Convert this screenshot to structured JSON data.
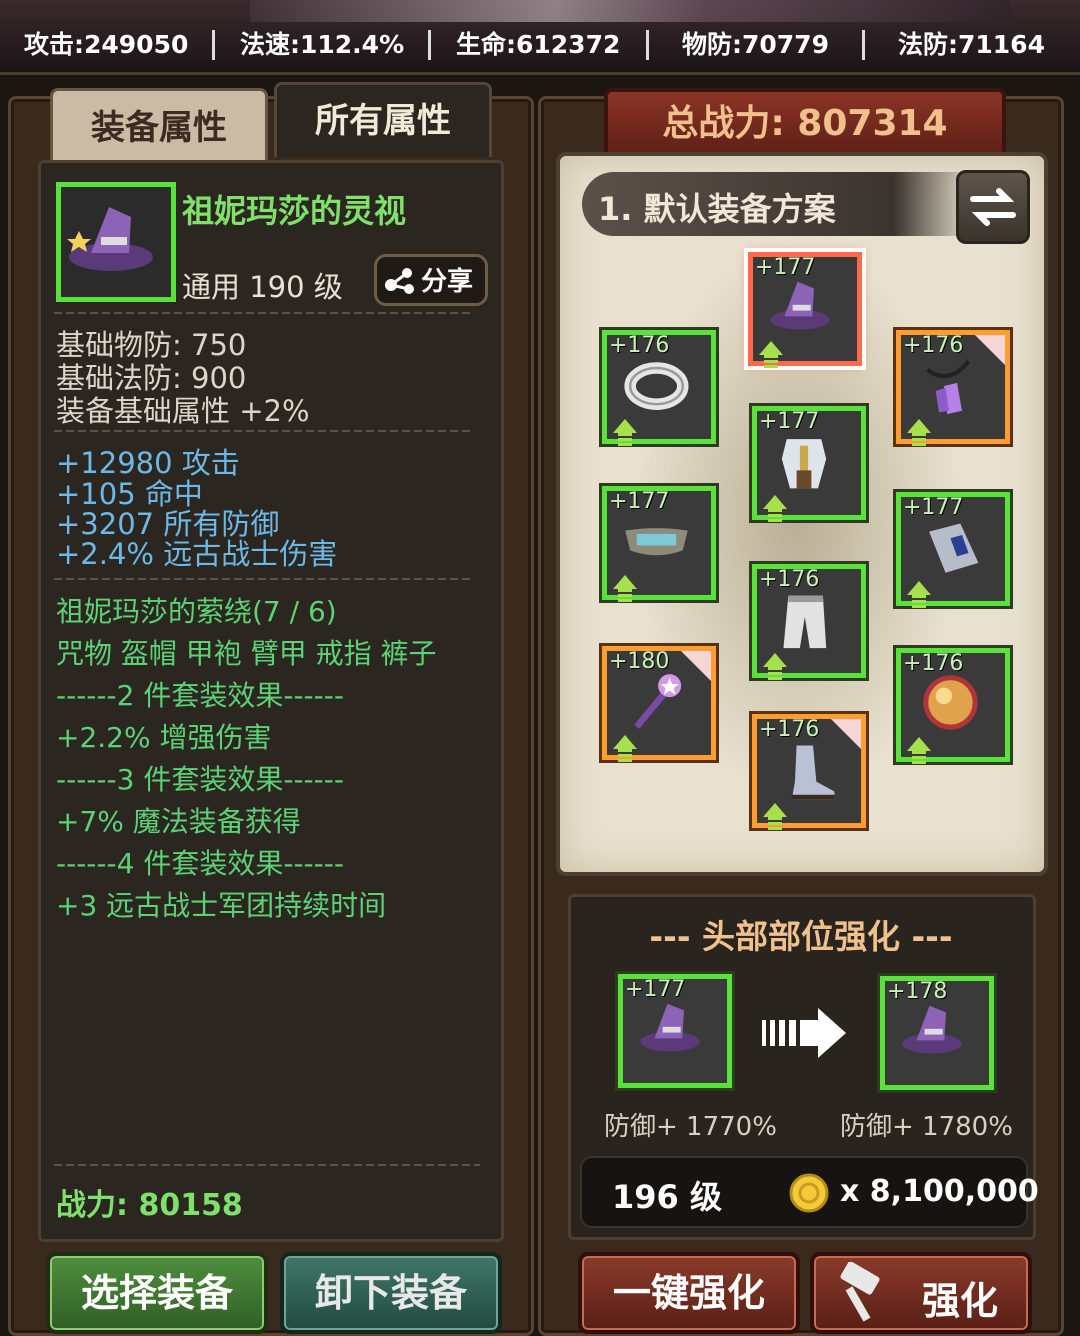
{
  "stats": {
    "attack": "攻击:249050",
    "cast_speed": "法速:112.4%",
    "hp": "生命:612372",
    "phys_def": "物防:70779",
    "magic_def": "法防:71164"
  },
  "tabs": {
    "equip_attr": "装备属性",
    "all_attr": "所有属性"
  },
  "item": {
    "name": "祖妮玛莎的灵视",
    "type_level": "通用 190 级",
    "share_label": "分享",
    "base_stats": [
      "基础物防:  750",
      "基础法防:  900",
      "装备基础属性 +2%"
    ],
    "bonus_stats": [
      "+12980 攻击",
      "+105 命中",
      "+3207 所有防御",
      "+2.4% 远古战士伤害"
    ],
    "set_name": "祖妮玛莎的萦绕(7 / 6)",
    "set_parts": "咒物 盔帽 甲袍 臂甲 戒指 裤子",
    "set_effects": [
      "------2 件套装效果------",
      "+2.2% 增强伤害",
      "------3 件套装效果------",
      "+7% 魔法装备获得",
      "------4 件套装效果------",
      "+3 远古战士军团持续时间"
    ],
    "power": "战力: 80158"
  },
  "buttons": {
    "select": "选择装备",
    "unequip": "卸下装备",
    "one_click": "一键强化",
    "enhance": "强化"
  },
  "total_power": "总战力: 807314",
  "loadout": {
    "name": "1. 默认装备方案",
    "slots": [
      {
        "id": "hat",
        "level": "+177",
        "rarity": "green",
        "icon": "wizard-hat-icon",
        "selected": true
      },
      {
        "id": "ring",
        "level": "+176",
        "rarity": "green",
        "icon": "ring-icon"
      },
      {
        "id": "amulet",
        "level": "+176",
        "rarity": "orange",
        "icon": "crystal-necklace-icon"
      },
      {
        "id": "armor",
        "level": "+177",
        "rarity": "green",
        "icon": "armor-icon"
      },
      {
        "id": "belt",
        "level": "+177",
        "rarity": "green",
        "icon": "belt-icon"
      },
      {
        "id": "bracer",
        "level": "+177",
        "rarity": "green",
        "icon": "bracer-icon"
      },
      {
        "id": "pants",
        "level": "+176",
        "rarity": "green",
        "icon": "pants-icon"
      },
      {
        "id": "wand",
        "level": "+180",
        "rarity": "orange",
        "icon": "wand-icon"
      },
      {
        "id": "orb",
        "level": "+176",
        "rarity": "green",
        "icon": "orb-icon"
      },
      {
        "id": "boots",
        "level": "+176",
        "rarity": "orange",
        "icon": "boots-icon"
      }
    ]
  },
  "enhance": {
    "title": "--- 头部部位强化 ---",
    "from_level": "+177",
    "to_level": "+178",
    "from_def": "防御+ 1770%",
    "to_def": "防御+ 1780%",
    "req_level": "196 级",
    "cost": "x 8,100,000"
  }
}
